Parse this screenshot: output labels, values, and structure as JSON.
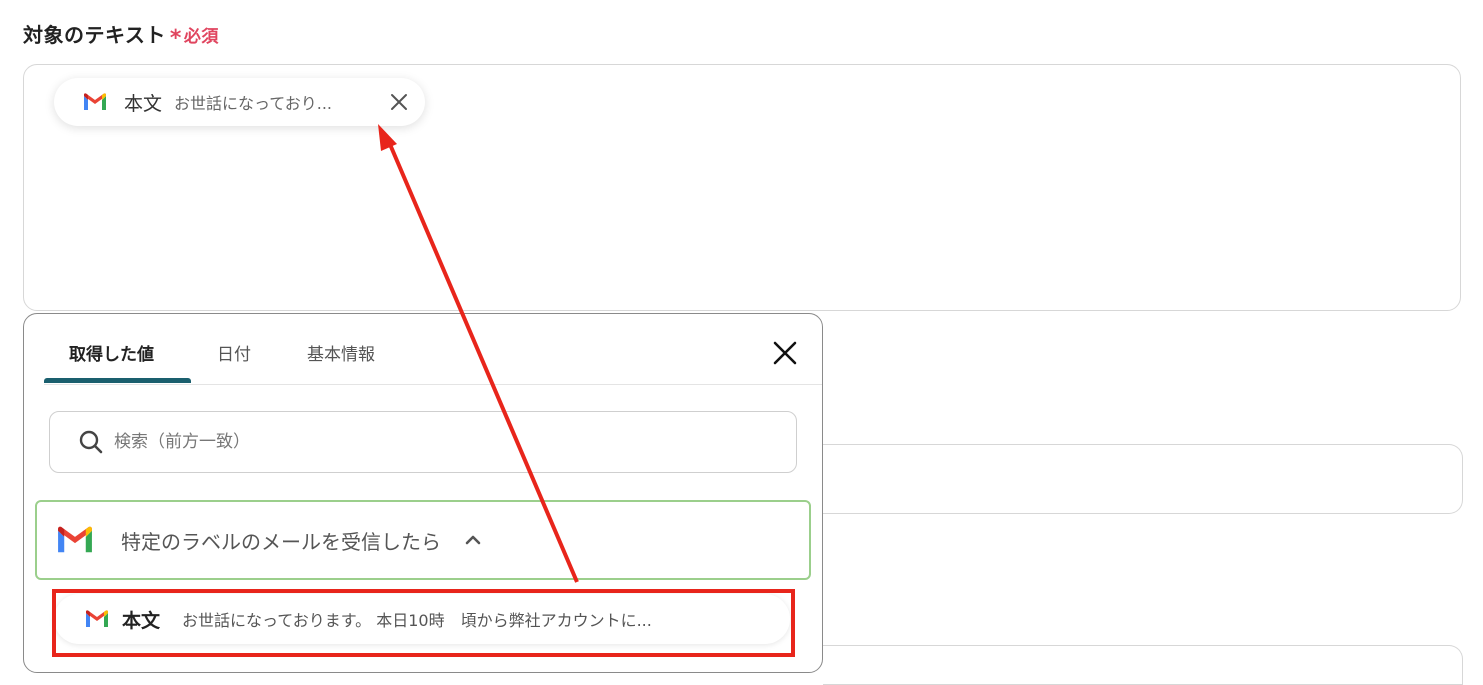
{
  "field": {
    "label": "対象のテキスト",
    "required_mark": "*",
    "required_text": "必須"
  },
  "selected_chip": {
    "icon": "gmail-icon",
    "title": "本文",
    "value": "お世話になっており...",
    "close_icon": "close-icon"
  },
  "popover": {
    "tabs": [
      "取得した値",
      "日付",
      "基本情報"
    ],
    "active_tab": "取得した値",
    "search_placeholder": "検索（前方一致）",
    "group": {
      "icon": "gmail-icon",
      "title": "特定のラベルのメールを受信したら",
      "expanded": true
    },
    "items": [
      {
        "icon": "gmail-icon",
        "title": "本文",
        "value": "お世話になっております。 本日10時　頃から弊社アカウントに..."
      }
    ]
  },
  "colors": {
    "required": "#e0455f",
    "tab_underline": "#1a5f6e",
    "group_border": "#9bcf8c",
    "annotation": "#e8251b",
    "gmail_red": "#ea4335",
    "gmail_blue": "#4285f4",
    "gmail_green": "#34a853",
    "gmail_yellow": "#fbbc04"
  }
}
